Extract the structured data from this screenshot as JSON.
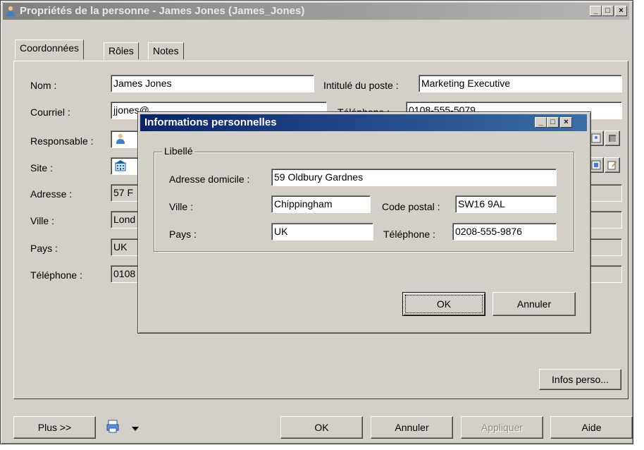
{
  "main_window": {
    "title": "Propriétés de la personne - James Jones (James_Jones)",
    "title_controls": {
      "minimize": "_",
      "maximize": "□",
      "close": "×"
    },
    "tabs": [
      {
        "label": "Coordonnées",
        "active": true
      },
      {
        "label": "Rôles",
        "active": false
      },
      {
        "label": "Notes",
        "active": false
      }
    ],
    "fields": {
      "nom": {
        "label": "Nom :",
        "value": "James Jones"
      },
      "courriel": {
        "label": "Courriel :",
        "value": "jjones@"
      },
      "responsable": {
        "label": "Responsable :",
        "value": ""
      },
      "site": {
        "label": "Site :",
        "value": ""
      },
      "adresse": {
        "label": "Adresse :",
        "value": "57 F"
      },
      "ville": {
        "label": "Ville :",
        "value": "Lond"
      },
      "pays": {
        "label": "Pays :",
        "value": "UK"
      },
      "telephone": {
        "label": "Téléphone :",
        "value": "0108"
      },
      "intitule": {
        "label": "Intitulé du poste :",
        "value": "Marketing Executive"
      },
      "telephone2": {
        "label": "Téléphone :",
        "value": "0108-555-5079"
      }
    },
    "infos_perso_button": "Infos perso...",
    "footer": {
      "plus": "Plus >>",
      "ok": "OK",
      "annuler": "Annuler",
      "appliquer": "Appliquer",
      "aide": "Aide"
    }
  },
  "dialog": {
    "title": "Informations personnelles",
    "title_controls": {
      "minimize": "_",
      "maximize": "□",
      "close": "×"
    },
    "group_label": "Libellé",
    "adresse": {
      "label": "Adresse domicile :",
      "value": "59 Oldbury Gardnes"
    },
    "ville": {
      "label": "Ville :",
      "value": "Chippingham"
    },
    "code_postal": {
      "label": "Code postal :",
      "value": "SW16 9AL"
    },
    "pays": {
      "label": "Pays :",
      "value": "UK"
    },
    "telephone": {
      "label": "Téléphone :",
      "value": "0208-555-9876"
    },
    "ok": "OK",
    "annuler": "Annuler"
  },
  "colors": {
    "window_face": "#d4d0c8",
    "active_title_start": "#0a246a",
    "active_title_end": "#3a6ea5",
    "inactive_title_start": "#808080",
    "inactive_title_end": "#b5b5b5"
  }
}
